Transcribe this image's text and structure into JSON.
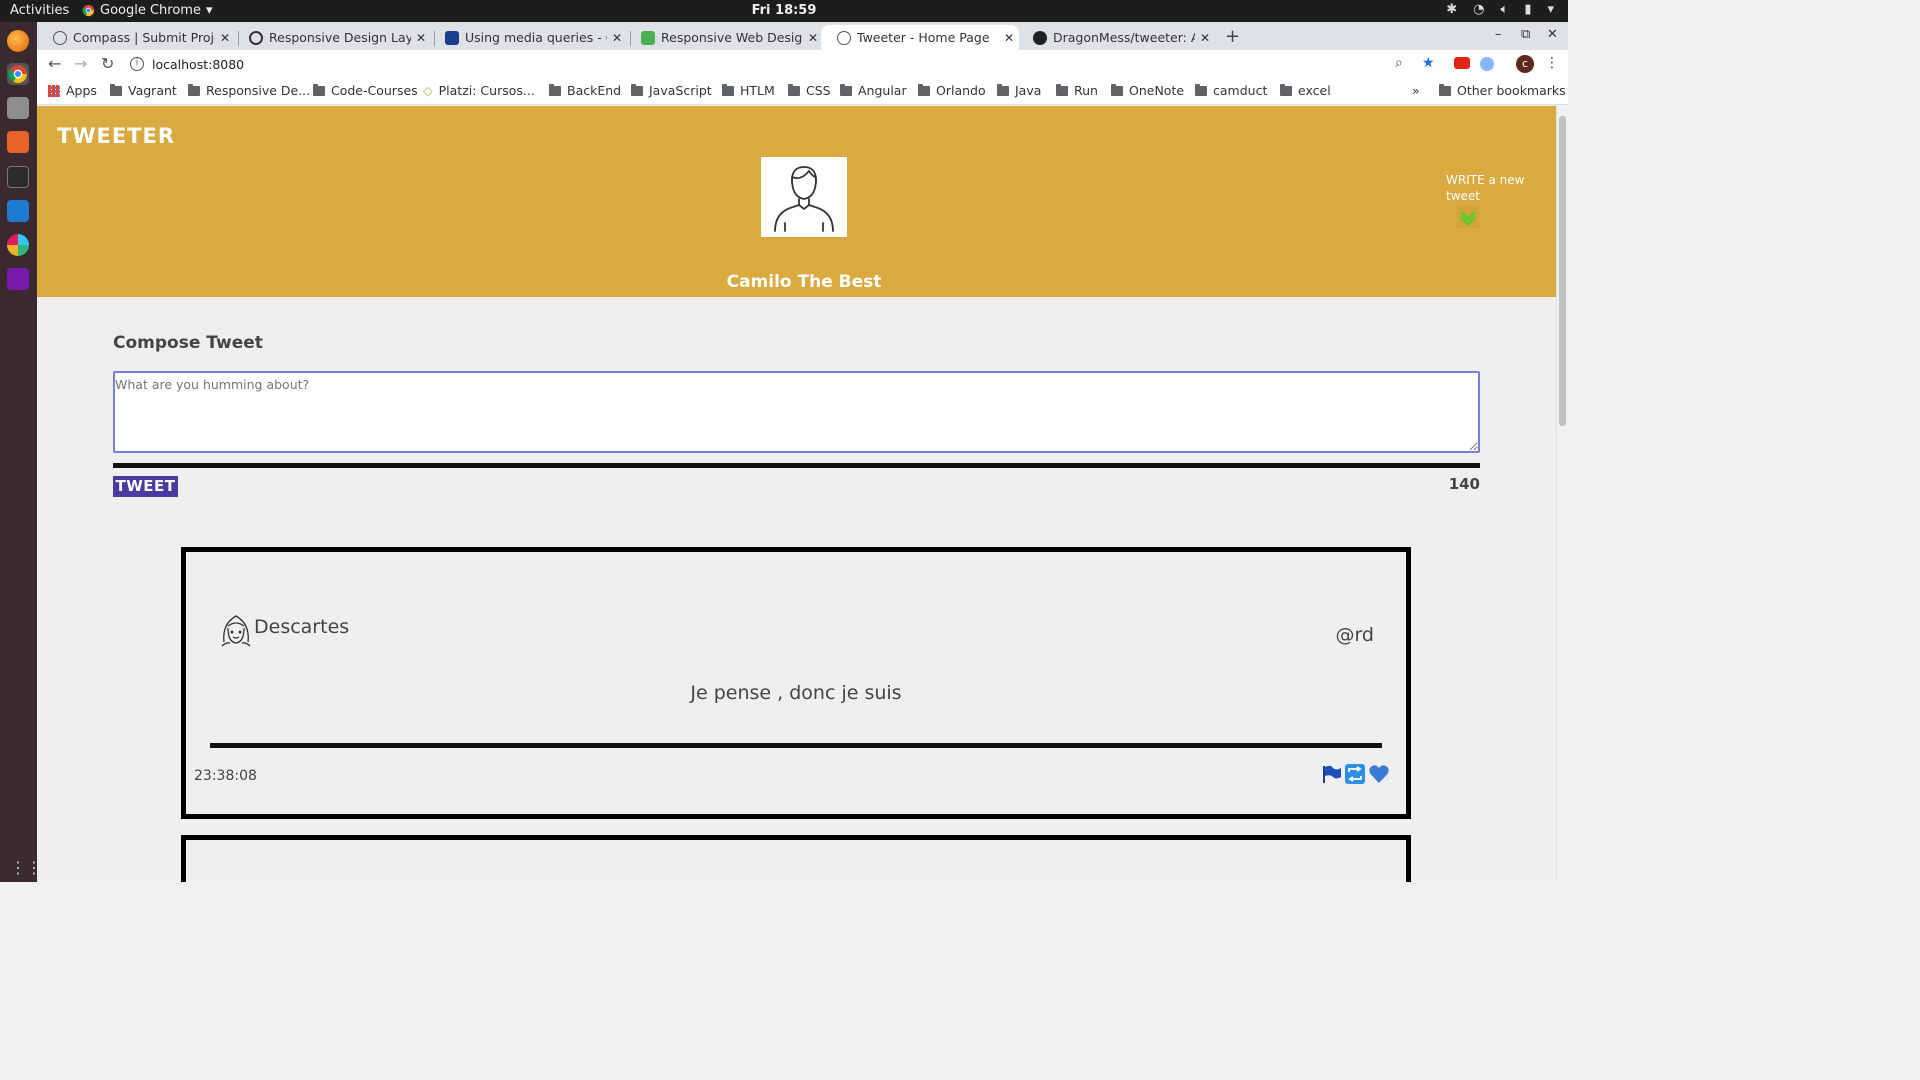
{
  "os": {
    "activities_label": "Activities",
    "app_name": "Google Chrome",
    "clock": "Fri 18:59"
  },
  "browser": {
    "tabs": [
      {
        "title": "Compass | Submit Project",
        "active": false
      },
      {
        "title": "Responsive Design Layout",
        "active": false
      },
      {
        "title": "Using media queries - CSS",
        "active": false
      },
      {
        "title": "Responsive Web Design V",
        "active": false
      },
      {
        "title": "Tweeter - Home Page",
        "active": true
      },
      {
        "title": "DragonMess/tweeter: A t",
        "active": false
      }
    ],
    "url": "localhost:8080",
    "bookmarks": [
      "Apps",
      "Vagrant",
      "Responsive De...",
      "Code-Courses",
      "Platzi: Cursos...",
      "BackEnd",
      "JavaScript",
      "HTLM",
      "CSS",
      "Angular",
      "Orlando",
      "Java",
      "Run",
      "OneNote",
      "camduct",
      "excel"
    ],
    "bookmarks_overflow": "»",
    "other_bookmarks": "Other bookmarks",
    "profile_initial": "c"
  },
  "page": {
    "brand": "TWEETER",
    "user_name": "Camilo The Best",
    "write_new_tweet": "WRITE a new tweet",
    "compose_title": "Compose Tweet",
    "compose_placeholder": "What are you humming about?",
    "tweet_button": "TWEET",
    "char_counter": "140",
    "header_color": "#d8aa40",
    "button_color": "#4b3aa0",
    "tweets": [
      {
        "name": "Descartes",
        "handle": "@rd",
        "content": "Je pense , donc je suis",
        "timestamp": "23:38:08",
        "actions": [
          "flag-icon",
          "retweet-icon",
          "heart-icon"
        ]
      }
    ]
  }
}
